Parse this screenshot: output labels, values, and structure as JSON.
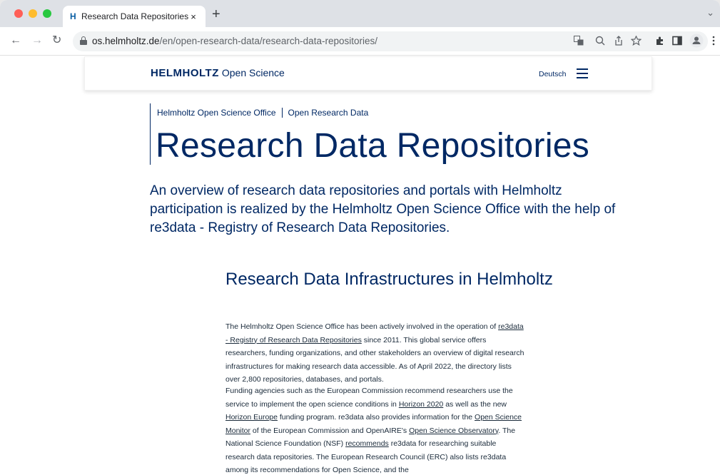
{
  "browser": {
    "tab_title": "Research Data Repositories - H",
    "tab_favicon": "H",
    "tab_close": "×",
    "new_tab": "+",
    "tab_menu": "⌄",
    "url_host": "os.helmholtz.de",
    "url_path": "/en/open-research-data/research-data-repositories/",
    "icons": [
      "back-icon",
      "forward-icon",
      "reload-icon",
      "lock-icon",
      "translate-icon",
      "zoom-icon",
      "share-icon",
      "bookmark-star-icon",
      "extensions-icon",
      "sidepanel-icon",
      "profile-icon",
      "menu-icon"
    ]
  },
  "header": {
    "logo_strong": "HELMHOLTZ",
    "logo_sub": "Open Science",
    "lang": "Deutsch"
  },
  "breadcrumb": {
    "item1": "Helmholtz Open Science Office",
    "item2": "Open Research Data"
  },
  "title": "Research Data Repositories",
  "lead": "An overview of research data repositories and portals with Helmholtz participation is realized by the Helmholtz Open Science Office with the help of re3data - Registry of Research Data Repositories.",
  "section": {
    "title": "Research Data Infrastructures in Helmholtz",
    "p1_a": "The Helmholtz Open Science Office has been actively involved in the operation of ",
    "p1_link": "re3data - Registry of Research Data Repositories",
    "p1_b": " since 2011. This global service offers researchers, funding organizations, and other stakeholders an overview of digital research infrastructures for making research data accessible. As of April 2022, the directory lists over 2,800 repositories, databases, and portals.",
    "p2_a": "Funding agencies such as the European Commission recommend researchers use the service to implement the open science conditions in ",
    "p2_link1": "Horizon 2020",
    "p2_b": " as well as the new ",
    "p2_link2": "Horizon Europe",
    "p2_c": " funding program. re3data also provides information for the ",
    "p2_link3": "Open Science Monitor",
    "p2_d": " of the European Commission and OpenAIRE's ",
    "p2_link4": "Open Science Observatory",
    "p2_e": ". The National Science Foundation (NSF) ",
    "p2_link5": "recommends",
    "p2_f": " re3data for researching suitable research data repositories. The European Research Council (ERC) also lists re3data among its recommendations for Open Science, and the"
  }
}
